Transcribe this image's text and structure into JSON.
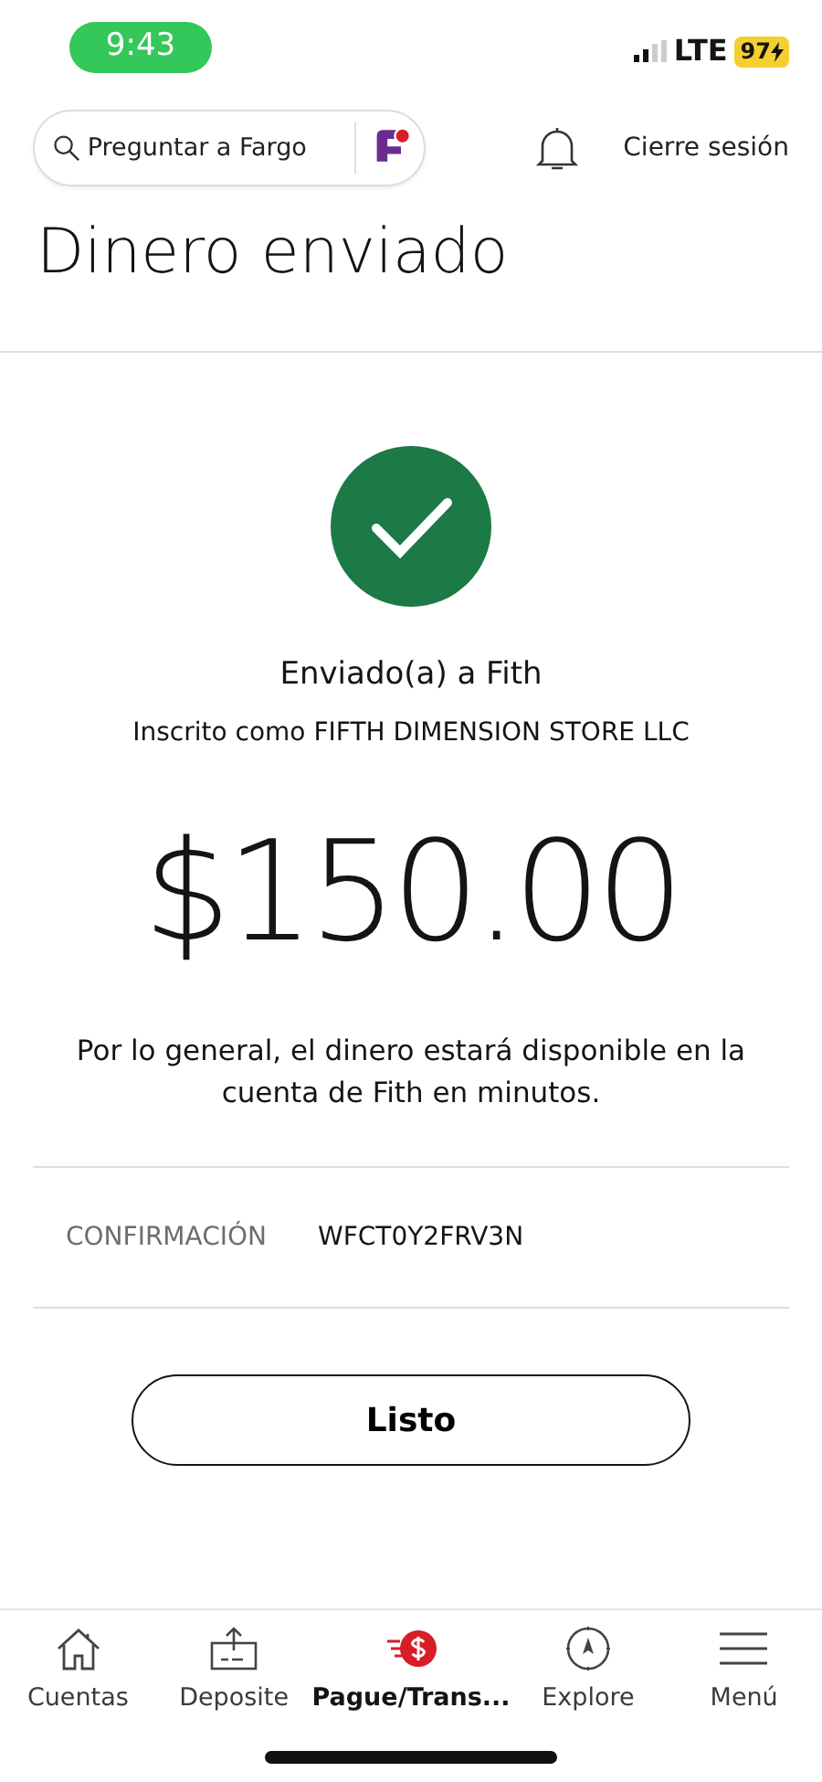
{
  "status_bar": {
    "time": "9:43",
    "network": "LTE",
    "battery": "97"
  },
  "header": {
    "search": {
      "placeholder": "Preguntar a Fargo"
    },
    "logout": "Cierre sesión"
  },
  "title": "Dinero enviado",
  "receipt": {
    "recipient": "Enviado(a) a Fith",
    "enrolled_as": "Inscrito como FIFTH DIMENSION STORE LLC",
    "amount": "$150.00",
    "message": "Por lo general, el dinero estará disponible en la cuenta de Fith en minutos.",
    "confirmation_label": "CONFIRMACIÓN",
    "confirmation_value": "WFCT0Y2FRV3N",
    "done_button": "Listo"
  },
  "tab_bar": [
    {
      "kind": "home",
      "label": "Cuentas",
      "selected": false
    },
    {
      "kind": "deposit",
      "label": "Deposite",
      "selected": false
    },
    {
      "kind": "pay",
      "label": "Pague/Trans...",
      "selected": true
    },
    {
      "kind": "compass",
      "label": "Explore",
      "selected": false
    },
    {
      "kind": "menu",
      "label": "Menú",
      "selected": false
    }
  ]
}
